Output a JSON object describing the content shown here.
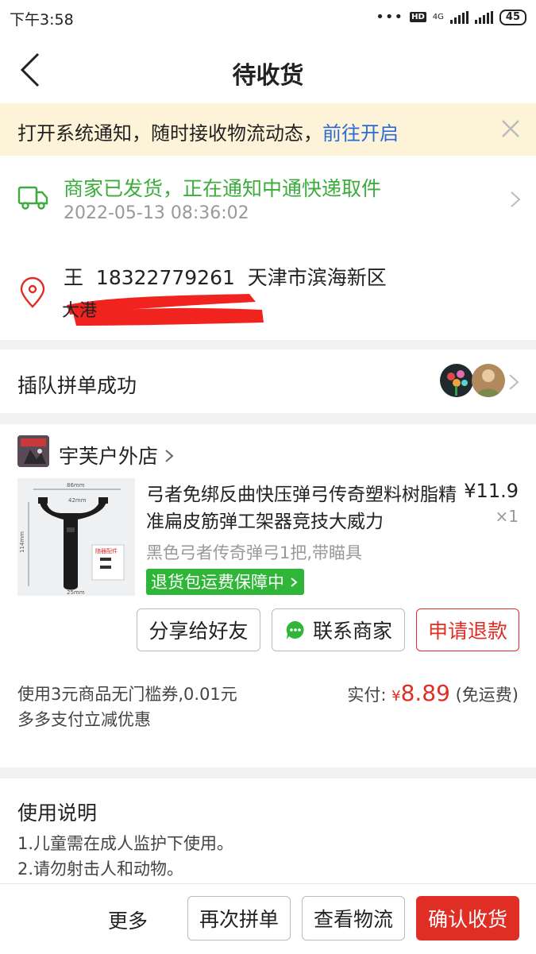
{
  "status_bar": {
    "time": "下午3:58",
    "signal_label": "4G",
    "hd": "HD",
    "battery": "45"
  },
  "header": {
    "title": "待收货"
  },
  "notice": {
    "text": "打开系统通知，随时接收物流动态，",
    "link": "前往开启"
  },
  "shipping": {
    "status": "商家已发货，正在通知中通快递取件",
    "time": "2022-05-13 08:36:02"
  },
  "address": {
    "name": "王",
    "phone": "18322779261",
    "region": "天津市滨海新区"
  },
  "group": {
    "label": "插队拼单成功"
  },
  "store": {
    "name": "宇芙户外店"
  },
  "product": {
    "title": "弓者免绑反曲快压弹弓传奇塑料树脂精准扁皮筋弹工架器竞技大威力",
    "price": "¥11.9",
    "quantity": "×1",
    "spec": "黑色弓者传奇弹弓1把,带瞄具",
    "badge": "退货包运费保障中",
    "image_labels": {
      "width_top": "86mm",
      "width_inner": "42mm",
      "height": "114mm",
      "bottom": "25mm",
      "tag": "随器配件"
    }
  },
  "actions": {
    "share": "分享给好友",
    "contact": "联系商家",
    "refund": "申请退款"
  },
  "payment": {
    "coupon": "使用3元商品无门槛券,0.01元多多支付立减优惠",
    "label": "实付:",
    "yen": "¥",
    "amount": "8.89",
    "shipping_note": "(免运费)"
  },
  "usage": {
    "title": "使用说明",
    "lines": [
      "1.儿童需在成人监护下使用。",
      "2.请勿射击人和动物。"
    ]
  },
  "bottom": {
    "more": "更多",
    "rebuy": "再次拼单",
    "logistics": "查看物流",
    "confirm": "确认收货"
  },
  "colors": {
    "accent_red": "#e02e24",
    "status_green": "#3cad3c",
    "badge_green": "#2fb538",
    "link_blue": "#2a6ad8",
    "notice_bg": "#fdf3d8"
  }
}
